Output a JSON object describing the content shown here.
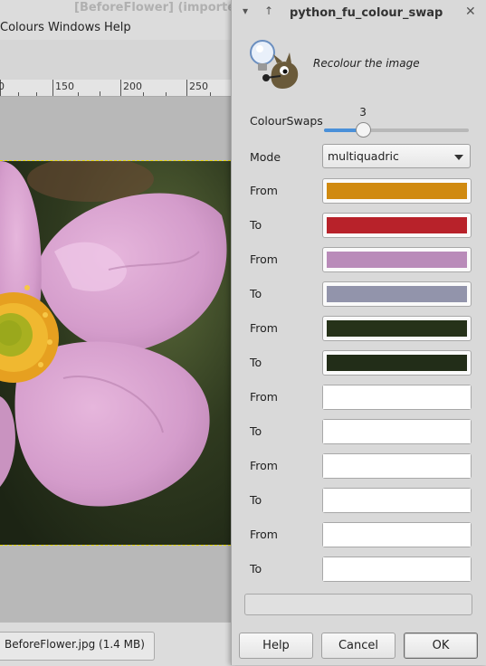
{
  "window": {
    "title": "[BeforeFlower] (imported)",
    "menu": [
      "Colours",
      "Windows",
      "Help"
    ]
  },
  "ruler": {
    "labels": [
      "0",
      "150",
      "200",
      "250"
    ]
  },
  "statusbar": {
    "file_info": "BeforeFlower.jpg (1.4 MB)"
  },
  "dialog": {
    "title": "python_fu_colour_swap",
    "blurb": "Recolour the image",
    "colour_swaps": {
      "label": "ColourSwaps",
      "value": "3",
      "fraction": 0.27
    },
    "mode": {
      "label": "Mode",
      "value": "multiquadric"
    },
    "swatches": [
      {
        "label": "From",
        "color": "#d08a10"
      },
      {
        "label": "To",
        "color": "#b8222a"
      },
      {
        "label": "From",
        "color": "#b98bb9"
      },
      {
        "label": "To",
        "color": "#9294ab"
      },
      {
        "label": "From",
        "color": "#263219"
      },
      {
        "label": "To",
        "color": "#222d18"
      },
      {
        "label": "From",
        "color": "#ffffff"
      },
      {
        "label": "To",
        "color": "#ffffff"
      },
      {
        "label": "From",
        "color": "#ffffff"
      },
      {
        "label": "To",
        "color": "#ffffff"
      },
      {
        "label": "From",
        "color": "#ffffff"
      },
      {
        "label": "To",
        "color": "#ffffff"
      }
    ],
    "buttons": {
      "help": "Help",
      "cancel": "Cancel",
      "ok": "OK"
    }
  }
}
